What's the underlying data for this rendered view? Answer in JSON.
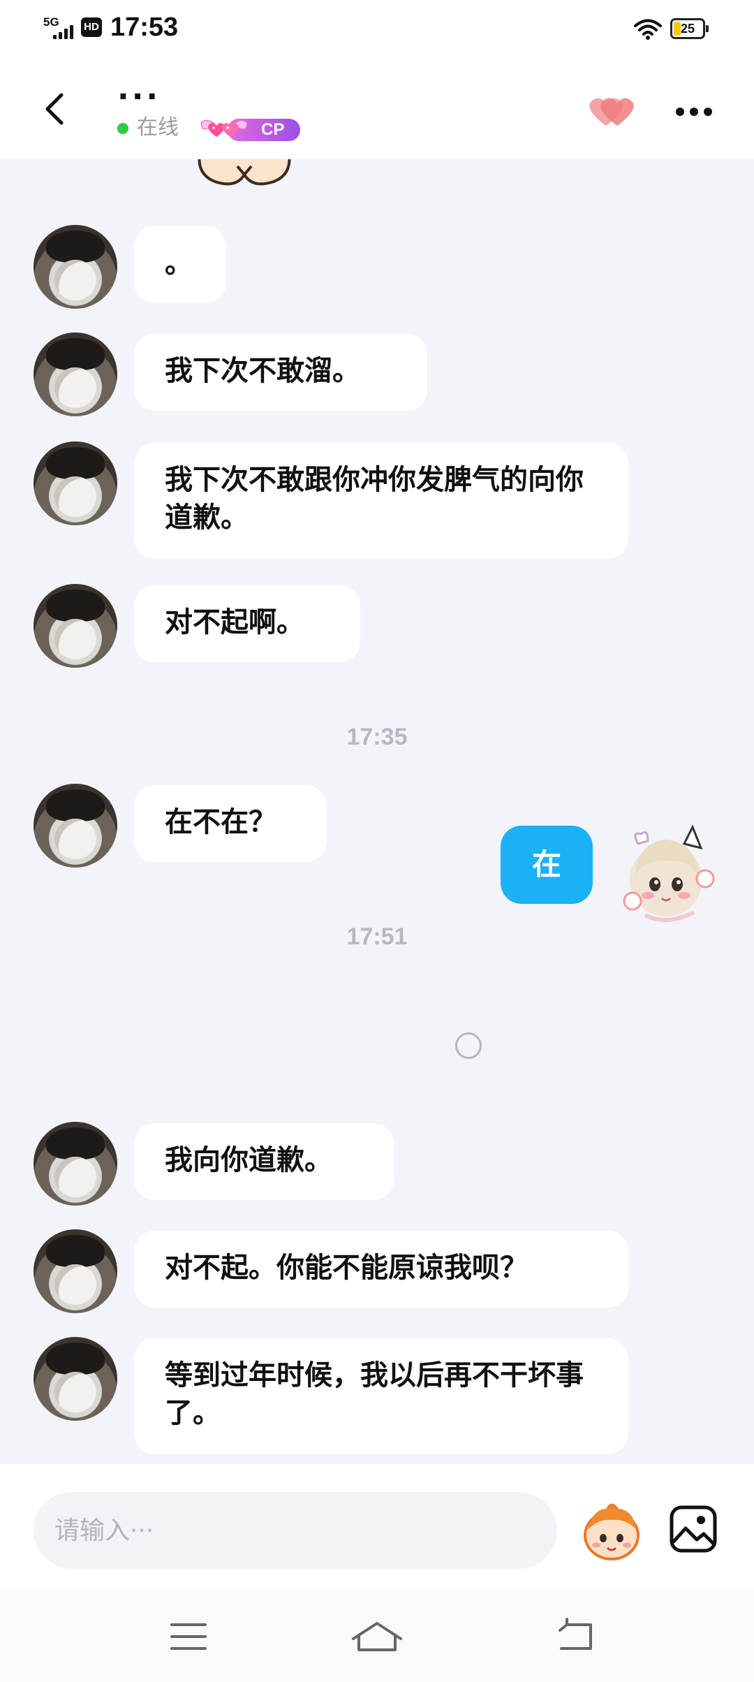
{
  "status_bar": {
    "network": "5G",
    "hd": "HD",
    "time": "17:53",
    "battery": "25",
    "icons": [
      "signal-icon",
      "wifi-icon",
      "battery-icon"
    ]
  },
  "header": {
    "name": "...",
    "presence": "在线",
    "badge": "CP",
    "accent": "#1ab2f5"
  },
  "messages": [
    {
      "from": "other",
      "text": "。"
    },
    {
      "from": "other",
      "text": "我下次不敢溜。"
    },
    {
      "from": "other",
      "text": "我下次不敢跟你冲你发脾气的向你道歉。"
    },
    {
      "from": "other",
      "text": "对不起啊。"
    },
    {
      "time": "17:35"
    },
    {
      "from": "other",
      "text": "在不在？"
    },
    {
      "time": "17:51"
    },
    {
      "from": "me",
      "text": "在"
    },
    {
      "from": "other",
      "text": "我向你道歉。"
    },
    {
      "from": "other",
      "text": "对不起。你能不能原谅我呗？"
    },
    {
      "from": "other",
      "text": "等到过年时候，我以后再不干坏事了。"
    }
  ],
  "input": {
    "placeholder": "请输入···"
  },
  "nav": {
    "icons": [
      "menu-icon",
      "home-icon",
      "back-icon"
    ]
  }
}
